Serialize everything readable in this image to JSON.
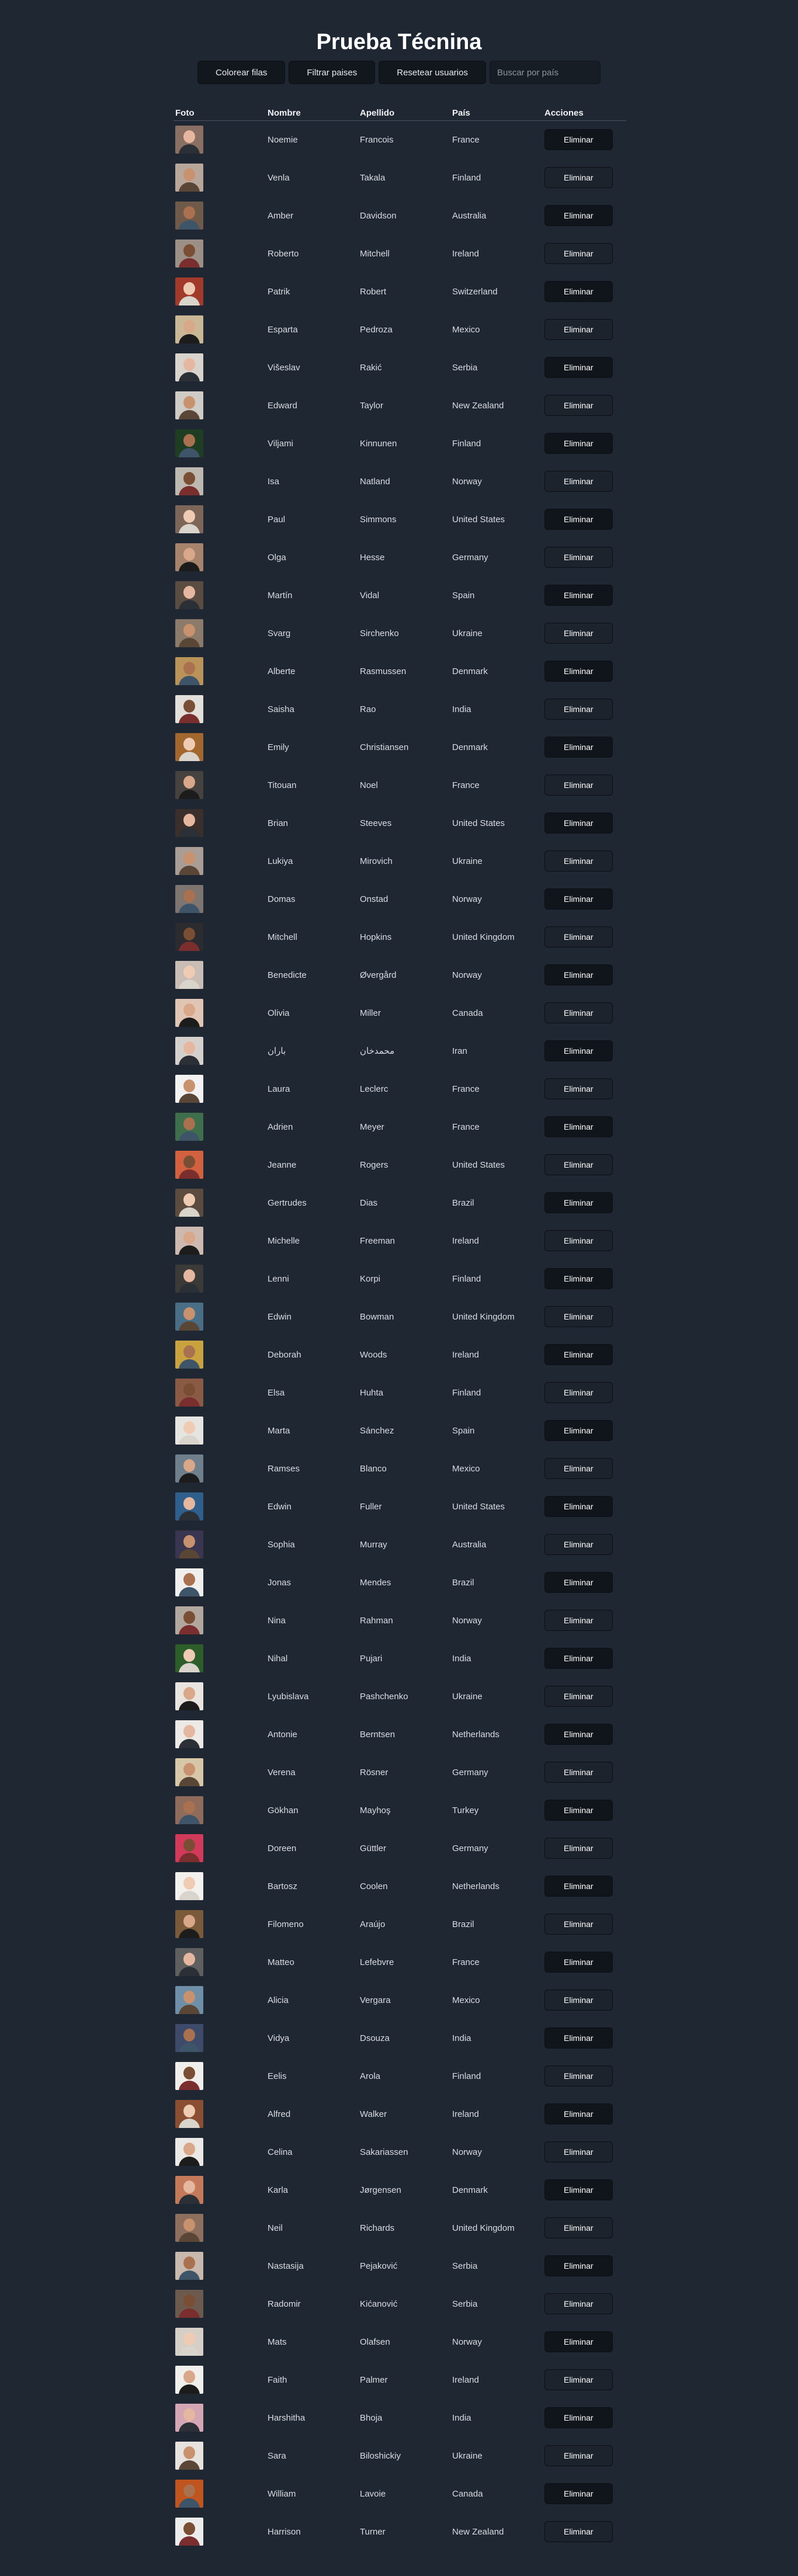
{
  "title": "Prueba Técnina",
  "controls": {
    "colorear_label": "Colorear filas",
    "filtrar_label": "Filtrar paises",
    "resetear_label": "Resetear usuarios",
    "search_placeholder": "Buscar por país"
  },
  "table": {
    "headers": [
      "Foto",
      "Nombre",
      "Apellido",
      "País",
      "Acciones"
    ],
    "delete_label": "Eliminar",
    "rows": [
      {
        "first": "Noemie",
        "last": "Francois",
        "country": "France"
      },
      {
        "first": "Venla",
        "last": "Takala",
        "country": "Finland"
      },
      {
        "first": "Amber",
        "last": "Davidson",
        "country": "Australia"
      },
      {
        "first": "Roberto",
        "last": "Mitchell",
        "country": "Ireland"
      },
      {
        "first": "Patrik",
        "last": "Robert",
        "country": "Switzerland"
      },
      {
        "first": "Esparta",
        "last": "Pedroza",
        "country": "Mexico"
      },
      {
        "first": "Višeslav",
        "last": "Rakić",
        "country": "Serbia"
      },
      {
        "first": "Edward",
        "last": "Taylor",
        "country": "New Zealand"
      },
      {
        "first": "Viljami",
        "last": "Kinnunen",
        "country": "Finland"
      },
      {
        "first": "Isa",
        "last": "Natland",
        "country": "Norway"
      },
      {
        "first": "Paul",
        "last": "Simmons",
        "country": "United States"
      },
      {
        "first": "Olga",
        "last": "Hesse",
        "country": "Germany"
      },
      {
        "first": "Martín",
        "last": "Vidal",
        "country": "Spain"
      },
      {
        "first": "Svarg",
        "last": "Sirchenko",
        "country": "Ukraine"
      },
      {
        "first": "Alberte",
        "last": "Rasmussen",
        "country": "Denmark"
      },
      {
        "first": "Saisha",
        "last": "Rao",
        "country": "India"
      },
      {
        "first": "Emily",
        "last": "Christiansen",
        "country": "Denmark"
      },
      {
        "first": "Titouan",
        "last": "Noel",
        "country": "France"
      },
      {
        "first": "Brian",
        "last": "Steeves",
        "country": "United States"
      },
      {
        "first": "Lukiya",
        "last": "Mirovich",
        "country": "Ukraine"
      },
      {
        "first": "Domas",
        "last": "Onstad",
        "country": "Norway"
      },
      {
        "first": "Mitchell",
        "last": "Hopkins",
        "country": "United Kingdom"
      },
      {
        "first": "Benedicte",
        "last": "Øvergård",
        "country": "Norway"
      },
      {
        "first": "Olivia",
        "last": "Miller",
        "country": "Canada"
      },
      {
        "first": "باران",
        "last": "محمدخان",
        "country": "Iran"
      },
      {
        "first": "Laura",
        "last": "Leclerc",
        "country": "France"
      },
      {
        "first": "Adrien",
        "last": "Meyer",
        "country": "France"
      },
      {
        "first": "Jeanne",
        "last": "Rogers",
        "country": "United States"
      },
      {
        "first": "Gertrudes",
        "last": "Dias",
        "country": "Brazil"
      },
      {
        "first": "Michelle",
        "last": "Freeman",
        "country": "Ireland"
      },
      {
        "first": "Lenni",
        "last": "Korpi",
        "country": "Finland"
      },
      {
        "first": "Edwin",
        "last": "Bowman",
        "country": "United Kingdom"
      },
      {
        "first": "Deborah",
        "last": "Woods",
        "country": "Ireland"
      },
      {
        "first": "Elsa",
        "last": "Huhta",
        "country": "Finland"
      },
      {
        "first": "Marta",
        "last": "Sánchez",
        "country": "Spain"
      },
      {
        "first": "Ramses",
        "last": "Blanco",
        "country": "Mexico"
      },
      {
        "first": "Edwin",
        "last": "Fuller",
        "country": "United States"
      },
      {
        "first": "Sophia",
        "last": "Murray",
        "country": "Australia"
      },
      {
        "first": "Jonas",
        "last": "Mendes",
        "country": "Brazil"
      },
      {
        "first": "Nina",
        "last": "Rahman",
        "country": "Norway"
      },
      {
        "first": "Nihal",
        "last": "Pujari",
        "country": "India"
      },
      {
        "first": "Lyubislava",
        "last": "Pashchenko",
        "country": "Ukraine"
      },
      {
        "first": "Antonie",
        "last": "Berntsen",
        "country": "Netherlands"
      },
      {
        "first": "Verena",
        "last": "Rösner",
        "country": "Germany"
      },
      {
        "first": "Gökhan",
        "last": "Mayhoş",
        "country": "Turkey"
      },
      {
        "first": "Doreen",
        "last": "Güttler",
        "country": "Germany"
      },
      {
        "first": "Bartosz",
        "last": "Coolen",
        "country": "Netherlands"
      },
      {
        "first": "Filomeno",
        "last": "Araújo",
        "country": "Brazil"
      },
      {
        "first": "Matteo",
        "last": "Lefebvre",
        "country": "France"
      },
      {
        "first": "Alicia",
        "last": "Vergara",
        "country": "Mexico"
      },
      {
        "first": "Vidya",
        "last": "Dsouza",
        "country": "India"
      },
      {
        "first": "Eelis",
        "last": "Arola",
        "country": "Finland"
      },
      {
        "first": "Alfred",
        "last": "Walker",
        "country": "Ireland"
      },
      {
        "first": "Celina",
        "last": "Sakariassen",
        "country": "Norway"
      },
      {
        "first": "Karla",
        "last": "Jørgensen",
        "country": "Denmark"
      },
      {
        "first": "Neil",
        "last": "Richards",
        "country": "United Kingdom"
      },
      {
        "first": "Nastasija",
        "last": "Pejaković",
        "country": "Serbia"
      },
      {
        "first": "Radomir",
        "last": "Kićanović",
        "country": "Serbia"
      },
      {
        "first": "Mats",
        "last": "Olafsen",
        "country": "Norway"
      },
      {
        "first": "Faith",
        "last": "Palmer",
        "country": "Ireland"
      },
      {
        "first": "Harshitha",
        "last": "Bhoja",
        "country": "India"
      },
      {
        "first": "Sara",
        "last": "Biloshickiy",
        "country": "Ukraine"
      },
      {
        "first": "William",
        "last": "Lavoie",
        "country": "Canada"
      },
      {
        "first": "Harrison",
        "last": "Turner",
        "country": "New Zealand"
      }
    ]
  }
}
